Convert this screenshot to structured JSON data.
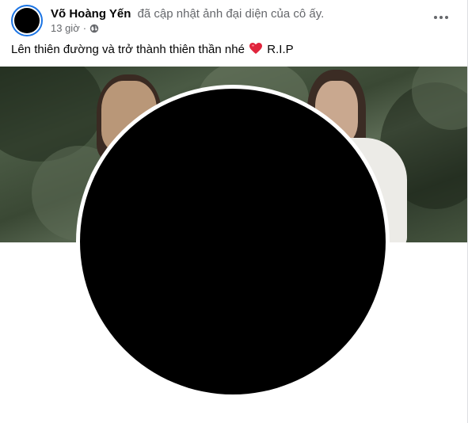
{
  "post": {
    "author": "Võ Hoàng Yến",
    "action": "đã cập nhật ảnh đại diện của cô ấy.",
    "time": "13 giờ",
    "text_before": "Lên thiên đường và trở thành thiên thần nhé",
    "text_after": "R.I.P",
    "icons": {
      "globe": "globe-icon",
      "more": "more-options-icon",
      "heart": "heart-icon"
    },
    "colors": {
      "avatar_ring": "#1b74e4",
      "heart": "#e0243c",
      "secondary_text": "#65676b"
    }
  }
}
